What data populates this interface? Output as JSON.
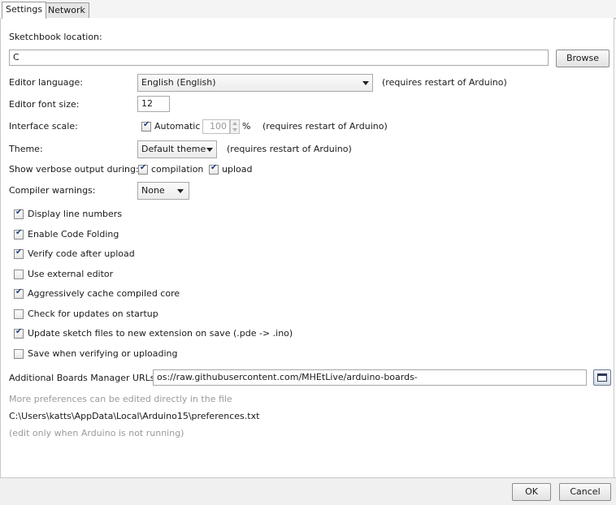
{
  "tabs": [
    {
      "label": "Settings",
      "active": true
    },
    {
      "label": "Network",
      "active": false
    }
  ],
  "sketchbook": {
    "label": "Sketchbook location:",
    "value": "C",
    "browse_label": "Browse"
  },
  "editor_language": {
    "label": "Editor language:",
    "value": "English (English)",
    "note": "(requires restart of Arduino)"
  },
  "editor_font_size": {
    "label": "Editor font size:",
    "value": "12"
  },
  "interface_scale": {
    "label": "Interface scale:",
    "automatic_label": "Automatic",
    "automatic_checked": true,
    "value": "100",
    "unit": "%",
    "note": "(requires restart of Arduino)"
  },
  "theme": {
    "label": "Theme:",
    "value": "Default theme",
    "note": "(requires restart of Arduino)"
  },
  "verbose": {
    "label": "Show verbose output during:",
    "compilation_label": "compilation",
    "compilation_checked": true,
    "upload_label": "upload",
    "upload_checked": true
  },
  "compiler_warnings": {
    "label": "Compiler warnings:",
    "value": "None"
  },
  "options": [
    {
      "label": "Display line numbers",
      "checked": true
    },
    {
      "label": "Enable Code Folding",
      "checked": true
    },
    {
      "label": "Verify code after upload",
      "checked": true
    },
    {
      "label": "Use external editor",
      "checked": false
    },
    {
      "label": "Aggressively cache compiled core",
      "checked": true
    },
    {
      "label": "Check for updates on startup",
      "checked": false
    },
    {
      "label": "Update sketch files to new extension on save (.pde -> .ino)",
      "checked": true
    },
    {
      "label": "Save when verifying or uploading",
      "checked": false
    }
  ],
  "boards_urls": {
    "label": "Additional Boards Manager URLs:",
    "value": "os://raw.githubusercontent.com/MHEtLive/arduino-boards-index/master/package_mhetlive_index.json",
    "icon": "window-icon"
  },
  "footer_info": {
    "more_prefs": "More preferences can be edited directly in the file",
    "path": "C:\\Users\\katts\\AppData\\Local\\Arduino15\\preferences.txt",
    "edit_note": "(edit only when Arduino is not running)"
  },
  "buttons": {
    "ok": "OK",
    "cancel": "Cancel"
  }
}
